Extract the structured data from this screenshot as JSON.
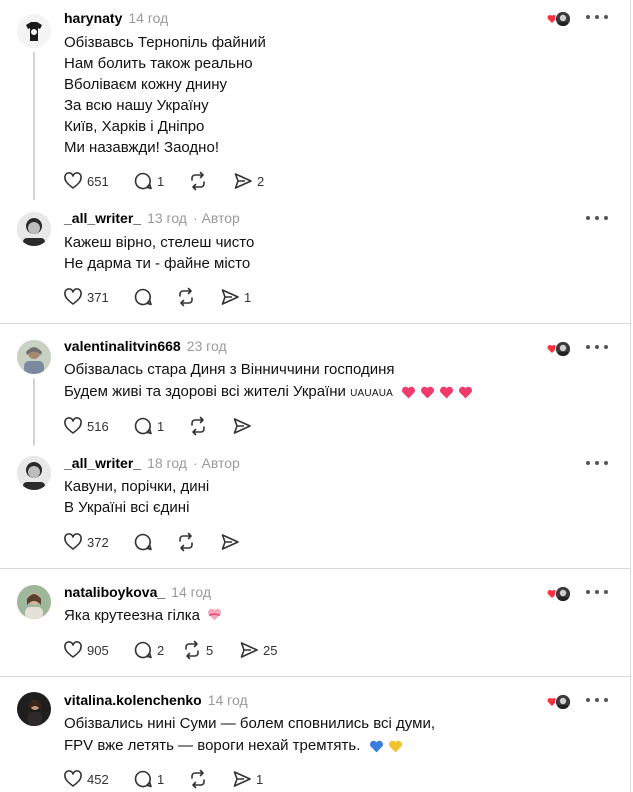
{
  "posts": [
    {
      "username": "harynaty",
      "time": "14 год",
      "lines": [
        "Обізвавсь Тернопіль файний",
        "Нам болить також реально",
        "Вболіваєм кожну днину",
        "За всю нашу Україну",
        "Київ, Харків і Дніпро",
        "Ми назавжди! Заодно!"
      ],
      "likes": "651",
      "replies": "1",
      "reposts": "",
      "shares": "2"
    },
    {
      "username": "_all_writer_",
      "time": "13 год",
      "author_badge": "Автор",
      "lines": [
        "Кажеш вірно, стелеш чисто",
        "Не дарма ти - файне місто"
      ],
      "likes": "371",
      "replies": "",
      "reposts": "",
      "shares": "1"
    },
    {
      "username": "valentinalitvin668",
      "time": "23 год",
      "lines": [
        "Обізвалась стара Диня з Вінниччини господиня",
        "Будем живі та здорові всі жителі України"
      ],
      "tag": "UAUAUA",
      "likes": "516",
      "replies": "1",
      "reposts": "",
      "shares": ""
    },
    {
      "username": "_all_writer_",
      "time": "18 год",
      "author_badge": "Автор",
      "lines": [
        "Кавуни, порічки, дині",
        "В Україні всі єдині"
      ],
      "likes": "372",
      "replies": "",
      "reposts": "",
      "shares": ""
    },
    {
      "username": "nataliboykova_",
      "time": "14 год",
      "lines": [
        "Яка крутеезна гілка"
      ],
      "likes": "905",
      "replies": "2",
      "reposts": "5",
      "shares": "25"
    },
    {
      "username": "vitalina.kolenchenko",
      "time": "14 год",
      "lines": [
        "Обізвались нині Суми — болем сповнились всі думи,",
        "FPV вже летять — вороги нехай тремтять."
      ],
      "likes": "452",
      "replies": "1",
      "reposts": "",
      "shares": "1"
    }
  ],
  "icons": {
    "like": "heart-outline-icon",
    "reply": "speech-bubble-icon",
    "repost": "repost-arrows-icon",
    "share": "paper-plane-icon",
    "more": "more-dots-icon",
    "liked_by_author": "red-heart-icon"
  },
  "colors": {
    "heart_red": "#ff3040",
    "heart_pink": "#f03a6b",
    "blue_heart": "#3b7ddd",
    "yellow_heart": "#f2c12e",
    "divider": "#dbdbdb",
    "meta_gray": "#9a9a9a"
  }
}
